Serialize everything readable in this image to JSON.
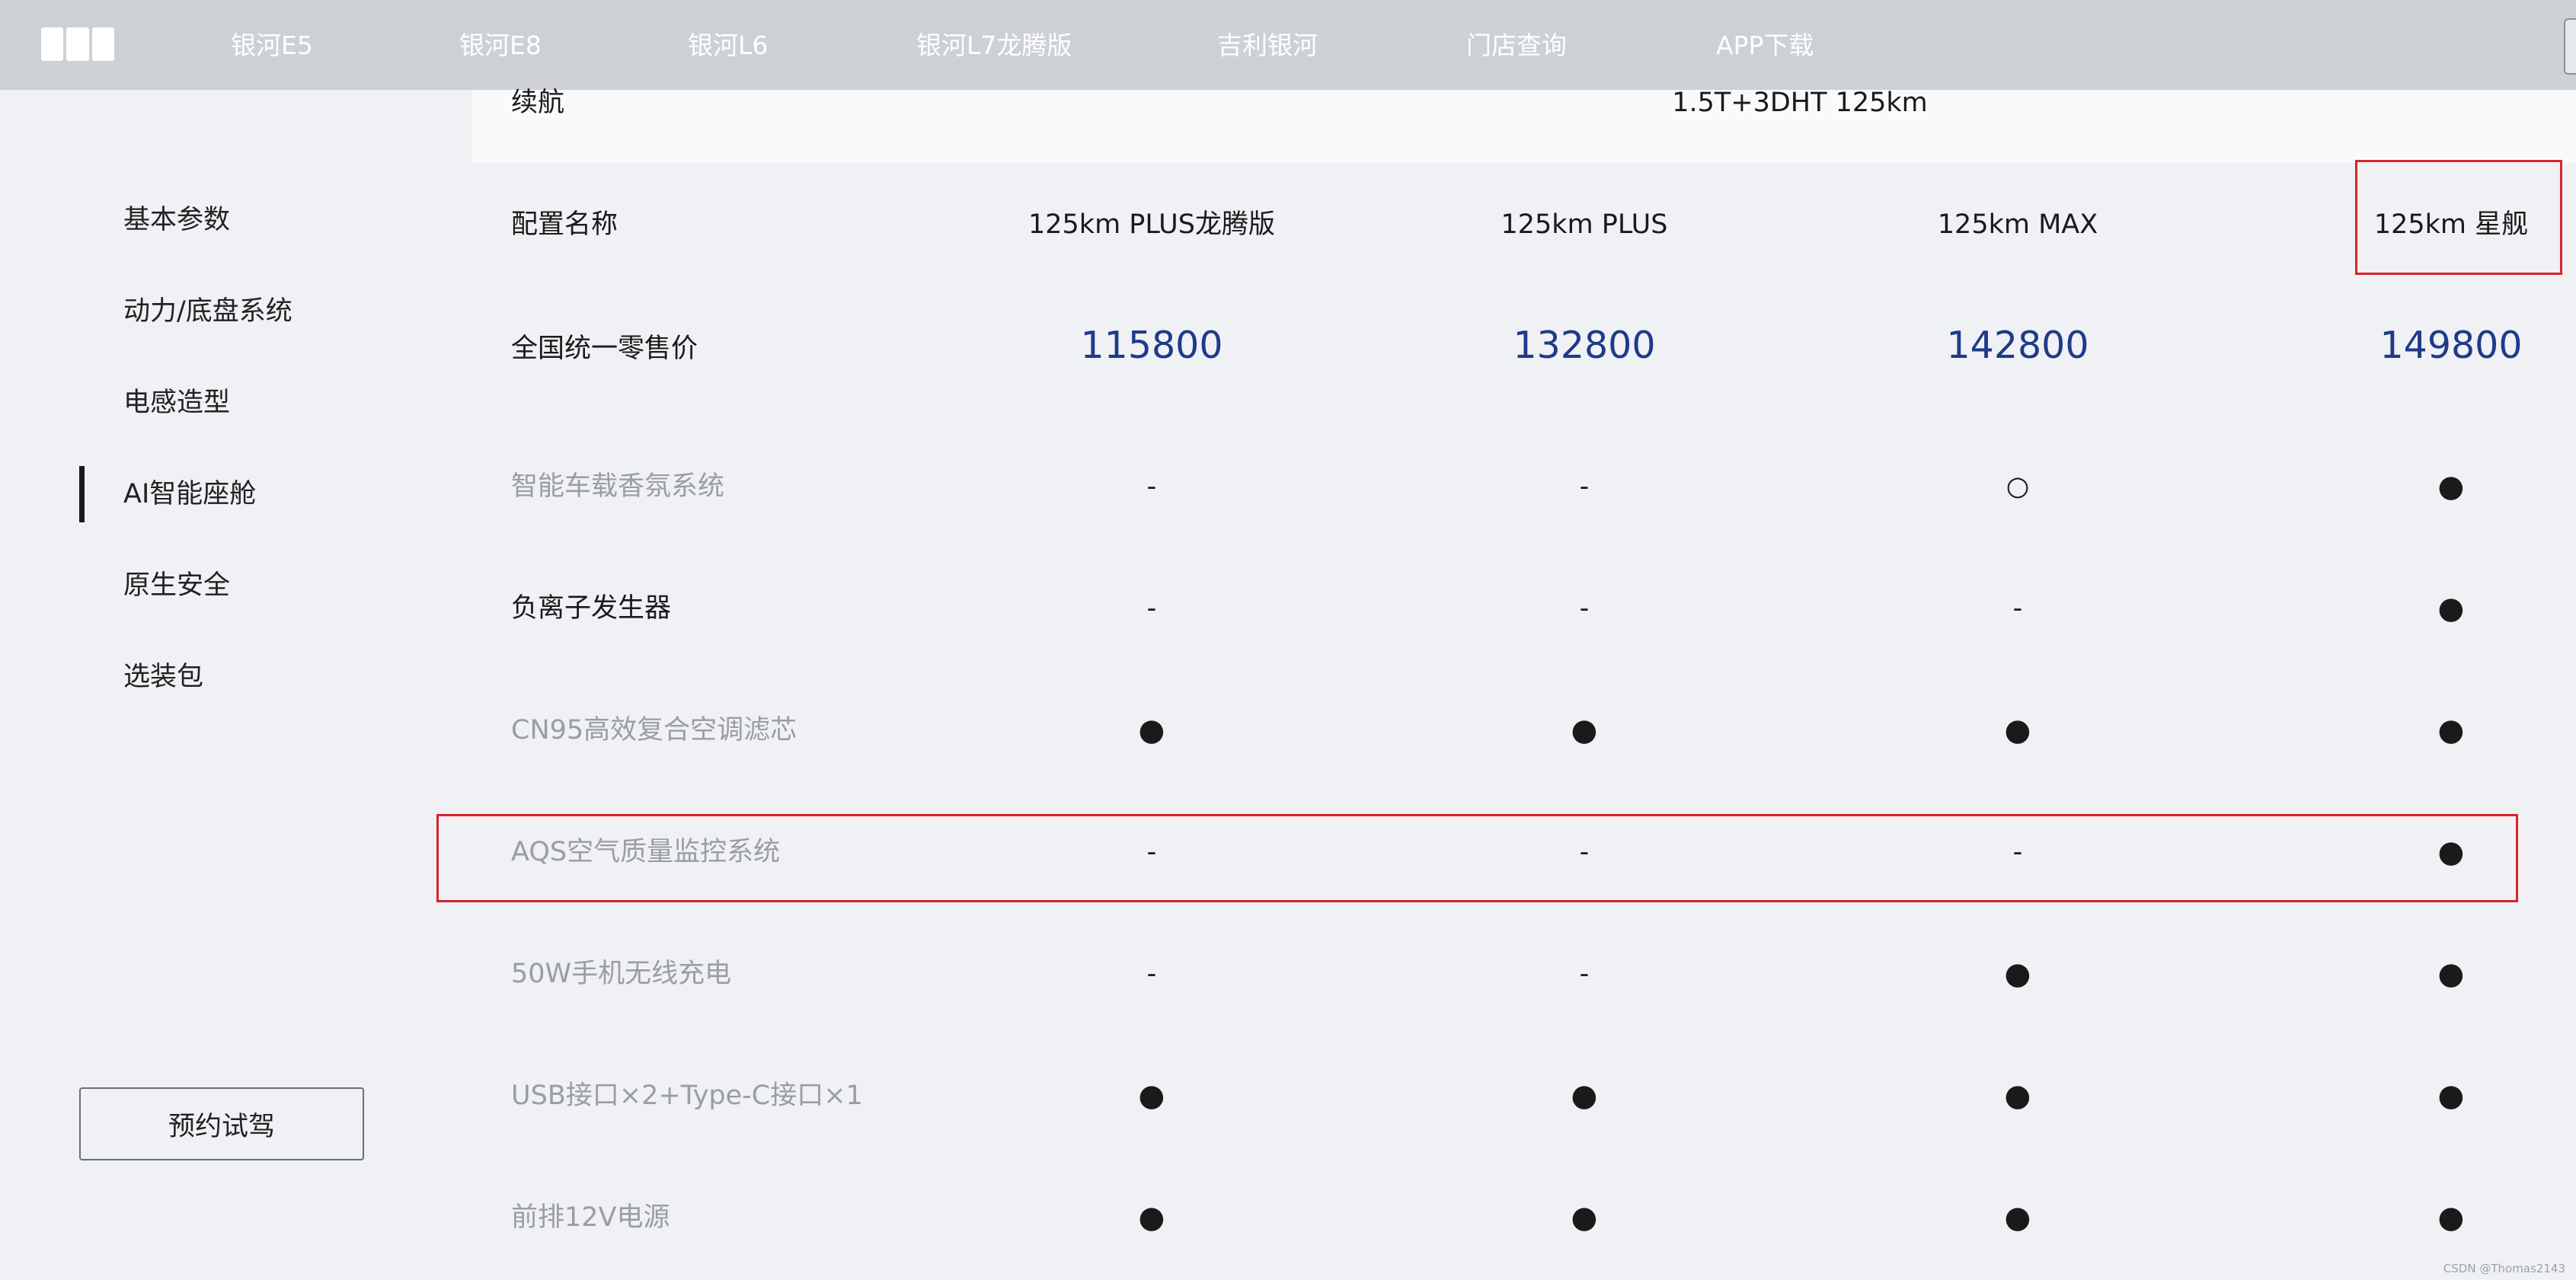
{
  "nav": {
    "items": [
      "银河E5",
      "银河E8",
      "银河L6",
      "银河L7龙腾版",
      "吉利银河",
      "门店查询",
      "APP下载"
    ]
  },
  "sidebar": {
    "items": [
      "基本参数",
      "动力/底盘系统",
      "电感造型",
      "AI智能座舱",
      "原生安全",
      "选装包"
    ],
    "active_index": 3,
    "test_drive_label": "预约试驾"
  },
  "spec": {
    "range_label": "续航",
    "range_value": "1.5T+3DHT 125km",
    "config_label": "配置名称",
    "configs": [
      "125km PLUS龙腾版",
      "125km PLUS",
      "125km MAX",
      "125km 星舰"
    ],
    "price_label": "全国统一零售价",
    "prices": [
      "115800",
      "132800",
      "142800",
      "149800"
    ],
    "features": [
      {
        "name": "智能车载香氛系统",
        "values": [
          "-",
          "-",
          "○",
          "●"
        ]
      },
      {
        "name": "负离子发生器",
        "values": [
          "-",
          "-",
          "-",
          "●"
        ]
      },
      {
        "name": "CN95高效复合空调滤芯",
        "values": [
          "●",
          "●",
          "●",
          "●"
        ]
      },
      {
        "name": "AQS空气质量监控系统",
        "values": [
          "-",
          "-",
          "-",
          "●"
        ]
      },
      {
        "name": "50W手机无线充电",
        "values": [
          "-",
          "-",
          "●",
          "●"
        ]
      },
      {
        "name": "USB接口×2+Type-C接口×1",
        "values": [
          "●",
          "●",
          "●",
          "●"
        ]
      },
      {
        "name": "前排12V电源",
        "values": [
          "●",
          "●",
          "●",
          "●"
        ]
      }
    ]
  },
  "colors": {
    "price": "#1f3a8a",
    "highlight": "#d6242b",
    "nav_bg": "#cdd1d6",
    "page_bg": "#eff1f4"
  },
  "watermark": "CSDN @Thomas2143"
}
